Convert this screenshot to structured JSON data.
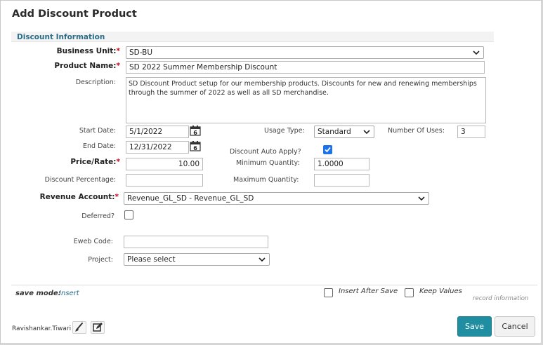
{
  "dialog": {
    "title": "Add Discount Product"
  },
  "section": {
    "title": "Discount Information"
  },
  "fields": {
    "business_unit": {
      "label": "Business Unit:",
      "value": "SD-BU"
    },
    "product_name": {
      "label": "Product Name:",
      "value": "SD 2022 Summer Membership Discount"
    },
    "description": {
      "label": "Description:",
      "value": "SD Discount Product setup for our membership products. Discounts for new and renewing memberships through the summer of 2022 as well as all SD merchandise."
    },
    "start_date": {
      "label": "Start Date:",
      "value": "5/1/2022"
    },
    "end_date": {
      "label": "End Date:",
      "value": "12/31/2022"
    },
    "usage_type": {
      "label": "Usage Type:",
      "value": "Standard"
    },
    "number_of_uses": {
      "label": "Number Of Uses:",
      "value": "3"
    },
    "discount_auto_apply": {
      "label": "Discount Auto Apply?",
      "checked": true
    },
    "price_rate": {
      "label": "Price/Rate:",
      "value": "10.00"
    },
    "minimum_quantity": {
      "label": "Minimum Quantity:",
      "value": "1.0000"
    },
    "discount_percentage": {
      "label": "Discount Percentage:",
      "value": ""
    },
    "maximum_quantity": {
      "label": "Maximum Quantity:",
      "value": ""
    },
    "revenue_account": {
      "label": "Revenue Account:",
      "value": "Revenue_GL_SD - Revenue_GL_SD"
    },
    "deferred": {
      "label": "Deferred?",
      "checked": false
    },
    "eweb_code": {
      "label": "Eweb Code:",
      "value": ""
    },
    "project": {
      "label": "Project:",
      "value": "Please select"
    }
  },
  "required_marker": "*",
  "calendar_icon_day": "6",
  "footer": {
    "save_mode_label": "save mode:",
    "save_mode_value": "Insert",
    "insert_after_save": "Insert After Save",
    "keep_values": "Keep Values",
    "record_information": "record information",
    "user": "Ravishankar.Tiwari",
    "save": "Save",
    "cancel": "Cancel"
  },
  "colors": {
    "accent": "#1f8ea1",
    "section_title": "#2b6c87",
    "required": "#d0021b",
    "checkbox": "#1a73e8"
  }
}
